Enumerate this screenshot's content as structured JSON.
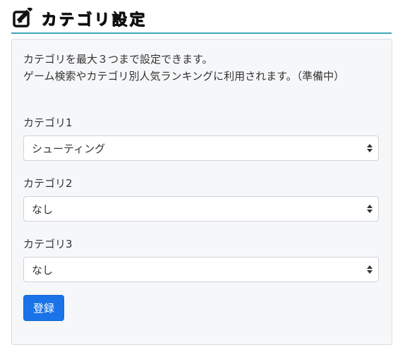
{
  "header": {
    "title": "カテゴリ設定",
    "icon": "edit-icon"
  },
  "description": {
    "line1": "カテゴリを最大３つまで設定できます。",
    "line2": "ゲーム検索やカテゴリ別人気ランキングに利用されます。（準備中）"
  },
  "categories": [
    {
      "label": "カテゴリ1",
      "value": "シューティング"
    },
    {
      "label": "カテゴリ2",
      "value": "なし"
    },
    {
      "label": "カテゴリ3",
      "value": "なし"
    }
  ],
  "submit": {
    "label": "登録"
  },
  "colors": {
    "accent": "#1a73e8",
    "heading_border": "#3aa9b8",
    "card_bg": "#f6f7f9"
  }
}
